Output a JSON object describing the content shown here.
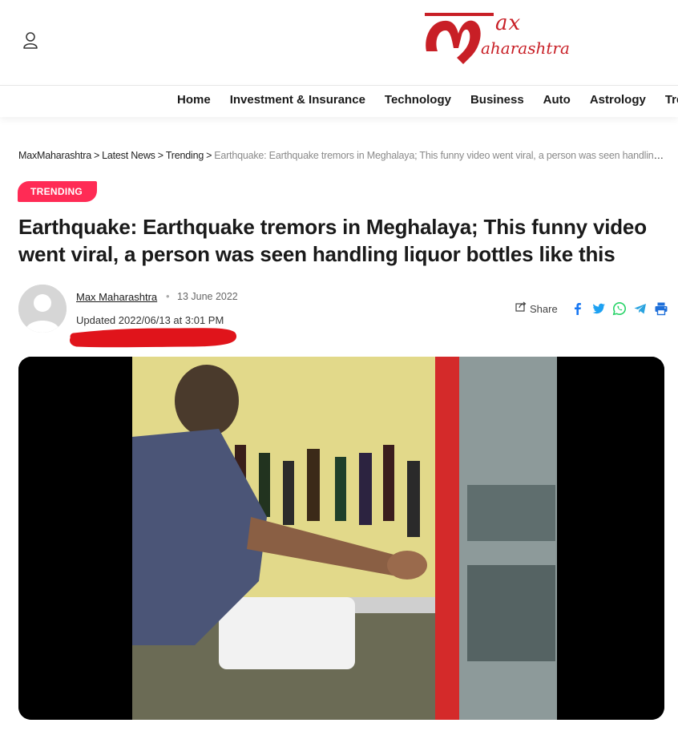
{
  "header": {
    "logo_alt": "Max Maharashtra",
    "logo_line1": "ax",
    "logo_line2": "aharashtra"
  },
  "nav": {
    "items": [
      "Home",
      "Investment & Insurance",
      "Technology",
      "Business",
      "Auto",
      "Astrology",
      "Trending"
    ]
  },
  "breadcrumb": {
    "items": [
      "MaxMaharashtra",
      "Latest News",
      "Trending"
    ],
    "separator": ">",
    "current": "Earthquake: Earthquake tremors in Meghalaya; This funny video went viral, a person was seen handling liquor bottles like this"
  },
  "article": {
    "category": "TRENDING",
    "title": "Earthquake: Earthquake tremors in Meghalaya; This funny video went viral, a person was seen handling liquor bottles like this",
    "author": "Max Maharashtra",
    "date": "13 June 2022",
    "updated": "Updated 2022/06/13 at 3:01 PM",
    "share_label": "Share"
  },
  "colors": {
    "brand_red": "#c81f26",
    "badge_pink": "#ff2b55",
    "facebook": "#1877f2",
    "twitter": "#1da1f2",
    "whatsapp": "#25d366",
    "telegram": "#2aa3df",
    "print": "#1e6fd9",
    "annotation_red": "#e0141b"
  },
  "icons": {
    "user": "user-icon",
    "share": "share-icon",
    "facebook": "facebook-icon",
    "twitter": "twitter-icon",
    "whatsapp": "whatsapp-icon",
    "telegram": "telegram-icon",
    "print": "print-icon"
  }
}
